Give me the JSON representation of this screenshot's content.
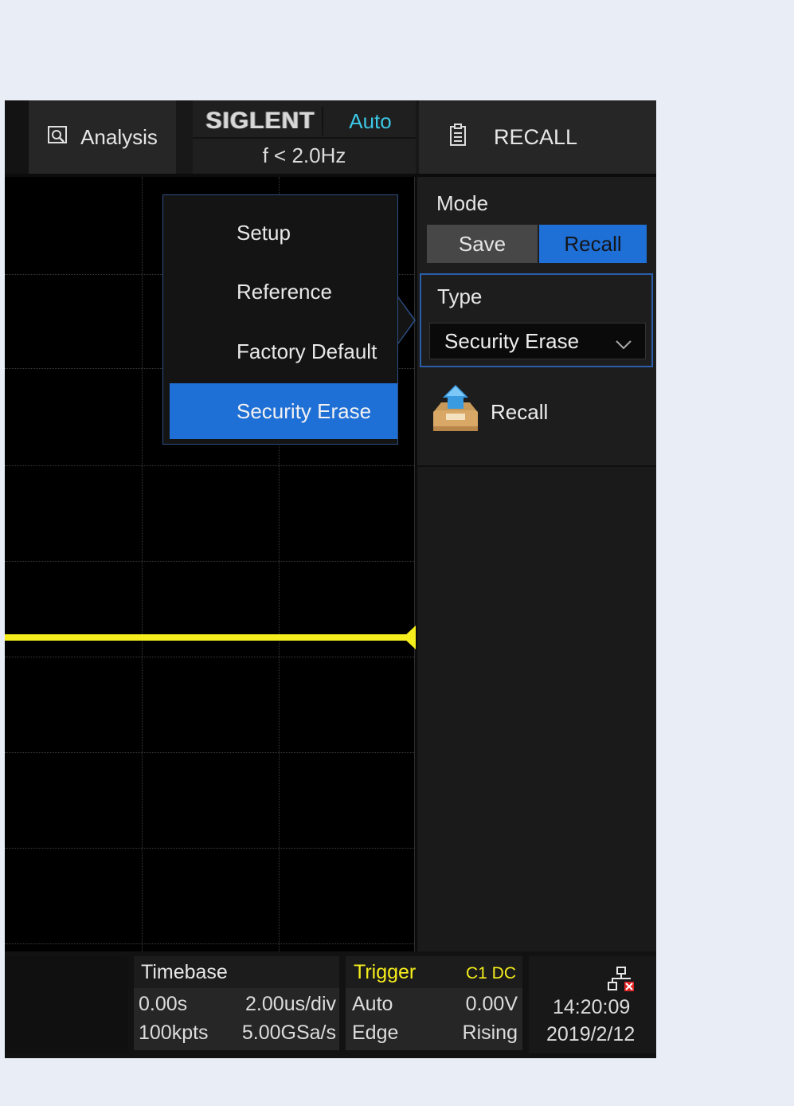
{
  "topbar": {
    "analysis_label": "Analysis",
    "brand": "SIGLENT",
    "trigger_mode": "Auto",
    "frequency": "f < 2.0Hz",
    "menu_title": "RECALL"
  },
  "popup_menu": {
    "items": [
      {
        "label": "Setup",
        "selected": false
      },
      {
        "label": "Reference",
        "selected": false
      },
      {
        "label": "Factory Default",
        "selected": false
      },
      {
        "label": "Security Erase",
        "selected": true
      }
    ]
  },
  "panel": {
    "mode_label": "Mode",
    "mode_options": [
      "Save",
      "Recall"
    ],
    "mode_selected": "Recall",
    "type_label": "Type",
    "type_value": "Security Erase",
    "recall_button_label": "Recall"
  },
  "bottombar": {
    "timebase": {
      "title": "Timebase",
      "delay": "0.00s",
      "scale": "2.00us/div",
      "memory_depth": "100kpts",
      "sample_rate": "5.00GSa/s"
    },
    "trigger": {
      "title": "Trigger",
      "source": "C1 DC",
      "mode": "Auto",
      "level": "0.00V",
      "type": "Edge",
      "slope": "Rising"
    },
    "clock": {
      "time": "14:20:09",
      "date": "2019/2/12"
    }
  },
  "colors": {
    "accent": "#1e6fd6",
    "channel1_trace": "#f5ee1c",
    "trigger_mode_text": "#3cc7e5"
  },
  "icons": [
    "analysis-icon",
    "recall-menu-icon",
    "chevron-down-icon",
    "recall-tray-icon",
    "network-disconnected-icon"
  ]
}
